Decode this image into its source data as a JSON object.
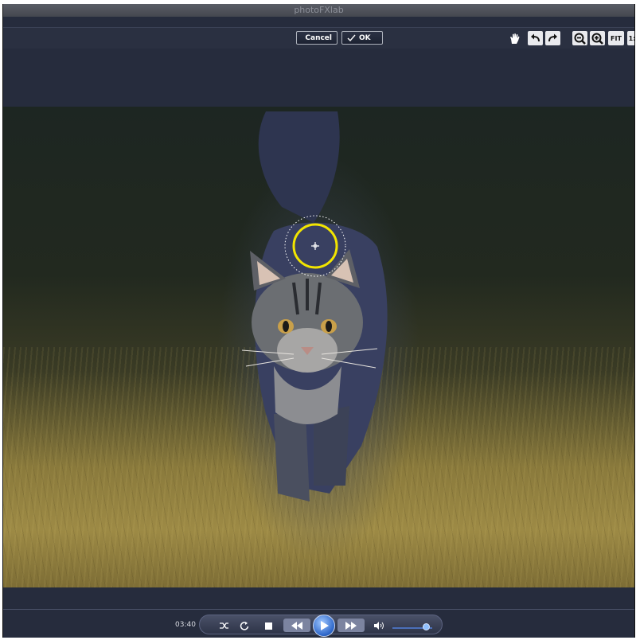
{
  "window": {
    "title": "photoFXlab"
  },
  "toolbar": {
    "cancel_label": "Cancel",
    "ok_label": "OK",
    "fit_label": "FIT",
    "one_to_one_label": "1:",
    "icons": [
      "hand-icon",
      "undo-icon",
      "redo-icon",
      "zoom-out-icon",
      "zoom-in-icon"
    ]
  },
  "player": {
    "time": "03:40",
    "volume_level": 0.85
  }
}
